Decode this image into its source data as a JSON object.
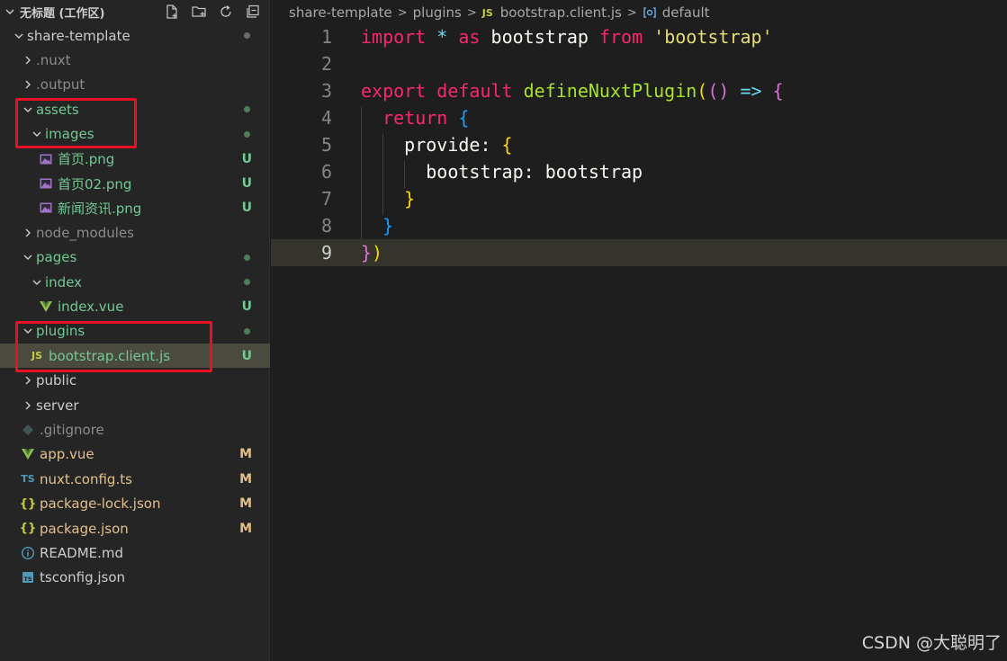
{
  "workspace": {
    "title": "无标题 (工作区)"
  },
  "tree": [
    {
      "name": "share-template",
      "type": "folder",
      "open": true,
      "indent": 0,
      "dot": "gray"
    },
    {
      "name": ".nuxt",
      "type": "folder",
      "open": false,
      "indent": 1,
      "muted": true
    },
    {
      "name": ".output",
      "type": "folder",
      "open": false,
      "indent": 1,
      "muted": true
    },
    {
      "name": "assets",
      "type": "folder",
      "open": true,
      "indent": 1,
      "color": "green",
      "dot": "green"
    },
    {
      "name": "images",
      "type": "folder",
      "open": true,
      "indent": 2,
      "color": "green",
      "dot": "green"
    },
    {
      "name": "首页.png",
      "type": "file",
      "icon": "image-icon",
      "indent": 3,
      "color": "green",
      "status": "U"
    },
    {
      "name": "首页02.png",
      "type": "file",
      "icon": "image-icon",
      "indent": 3,
      "color": "green",
      "status": "U"
    },
    {
      "name": "新闻资讯.png",
      "type": "file",
      "icon": "image-icon",
      "indent": 3,
      "color": "green",
      "status": "U"
    },
    {
      "name": "node_modules",
      "type": "folder",
      "open": false,
      "indent": 1,
      "muted": true
    },
    {
      "name": "pages",
      "type": "folder",
      "open": true,
      "indent": 1,
      "color": "green",
      "dot": "green"
    },
    {
      "name": "index",
      "type": "folder",
      "open": true,
      "indent": 2,
      "color": "green",
      "dot": "green"
    },
    {
      "name": "index.vue",
      "type": "file",
      "icon": "vue-icon",
      "indent": 3,
      "color": "green",
      "status": "U"
    },
    {
      "name": "plugins",
      "type": "folder",
      "open": true,
      "indent": 1,
      "color": "green",
      "dot": "green"
    },
    {
      "name": "bootstrap.client.js",
      "type": "file",
      "icon": "js-icon",
      "indent": 2,
      "color": "green",
      "status": "U",
      "active": true
    },
    {
      "name": "public",
      "type": "folder",
      "open": false,
      "indent": 1
    },
    {
      "name": "server",
      "type": "folder",
      "open": false,
      "indent": 1
    },
    {
      "name": ".gitignore",
      "type": "file",
      "icon": "git-icon",
      "indent": 1,
      "muted": true
    },
    {
      "name": "app.vue",
      "type": "file",
      "icon": "vue-icon",
      "indent": 1,
      "color": "yellow",
      "status": "M"
    },
    {
      "name": "nuxt.config.ts",
      "type": "file",
      "icon": "ts-icon",
      "indent": 1,
      "color": "yellow",
      "status": "M"
    },
    {
      "name": "package-lock.json",
      "type": "file",
      "icon": "json-icon",
      "indent": 1,
      "color": "yellow",
      "status": "M"
    },
    {
      "name": "package.json",
      "type": "file",
      "icon": "json-icon",
      "indent": 1,
      "color": "yellow",
      "status": "M"
    },
    {
      "name": "README.md",
      "type": "file",
      "icon": "info-icon",
      "indent": 1
    },
    {
      "name": "tsconfig.json",
      "type": "file",
      "icon": "tsconfig-icon",
      "indent": 1
    }
  ],
  "breadcrumb": [
    "share-template",
    "plugins",
    "bootstrap.client.js",
    "default"
  ],
  "code": {
    "current_line": 9,
    "lines": [
      "import * as bootstrap from 'bootstrap'",
      "",
      "export default defineNuxtPlugin(() => {",
      "  return {",
      "    provide: {",
      "      bootstrap: bootstrap",
      "    }",
      "  }",
      "})"
    ]
  },
  "watermark": "CSDN @大聪明了"
}
